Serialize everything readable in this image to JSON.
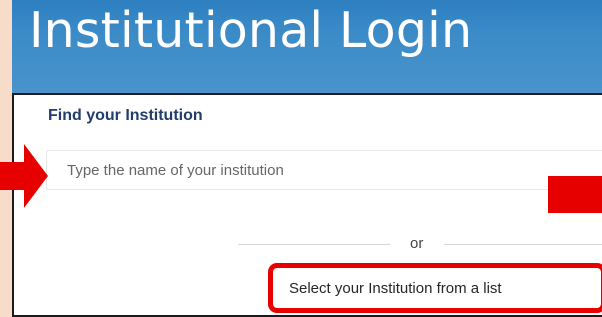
{
  "banner": {
    "title": "Institutional Login"
  },
  "panel": {
    "heading": "Find your Institution",
    "search": {
      "placeholder": "Type the name of your institution",
      "value": ""
    },
    "divider_text": "or",
    "select_list_label": "Select your Institution from a list"
  },
  "annotations": {
    "left_arrow": "arrow-right-icon",
    "right_marker": "red-marker",
    "highlight_color": "#e80000"
  },
  "colors": {
    "page_background": "#f6dcc9",
    "banner_blue": "#3b8bc8",
    "heading_navy": "#203d6b"
  }
}
